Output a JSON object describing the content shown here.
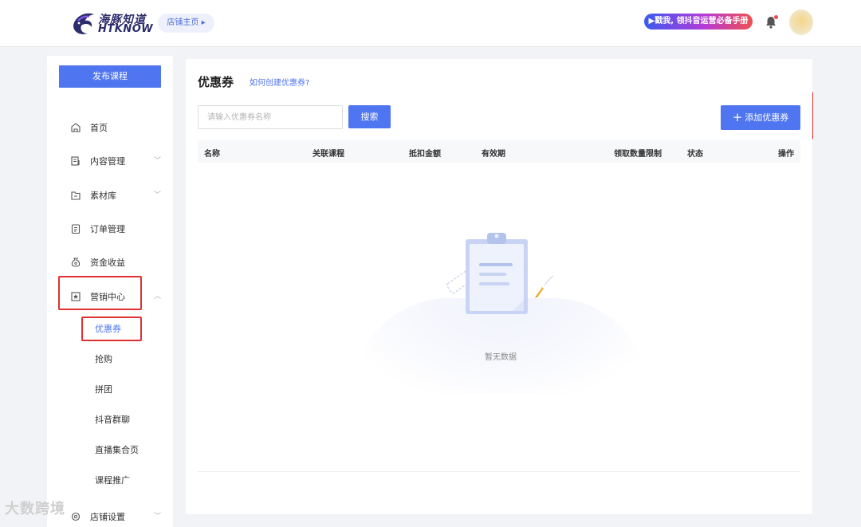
{
  "header": {
    "logo_cn": "海豚知道",
    "logo_en": "HTKNOW",
    "shop_home": "店铺主页 ▸",
    "promo": "▶戳我, 领抖音运营必备手册"
  },
  "sidebar": {
    "publish": "发布课程",
    "items": [
      {
        "label": "首页",
        "icon": "home-icon"
      },
      {
        "label": "内容管理",
        "icon": "content-icon"
      },
      {
        "label": "素材库",
        "icon": "folder-icon"
      },
      {
        "label": "订单管理",
        "icon": "order-icon"
      },
      {
        "label": "资金收益",
        "icon": "money-bag-icon"
      },
      {
        "label": "营销中心",
        "icon": "star-box-icon"
      }
    ],
    "sub_items": [
      "优惠券",
      "抢购",
      "拼团",
      "抖音群聊",
      "直播集合页",
      "课程推广"
    ],
    "last_item": "店铺设置"
  },
  "main": {
    "title": "优惠券",
    "help_link": "如何创建优惠券?",
    "search_placeholder": "请输入优惠券名称",
    "search_btn": "搜索",
    "add_btn": "添加优惠券",
    "columns": [
      "名称",
      "关联课程",
      "抵扣金额",
      "有效期",
      "领取数量限制",
      "状态",
      "操作"
    ],
    "empty_text": "暂无数据"
  },
  "watermark": "大数跨境",
  "colors": {
    "primary": "#4f75f0",
    "highlight": "#e03030"
  }
}
